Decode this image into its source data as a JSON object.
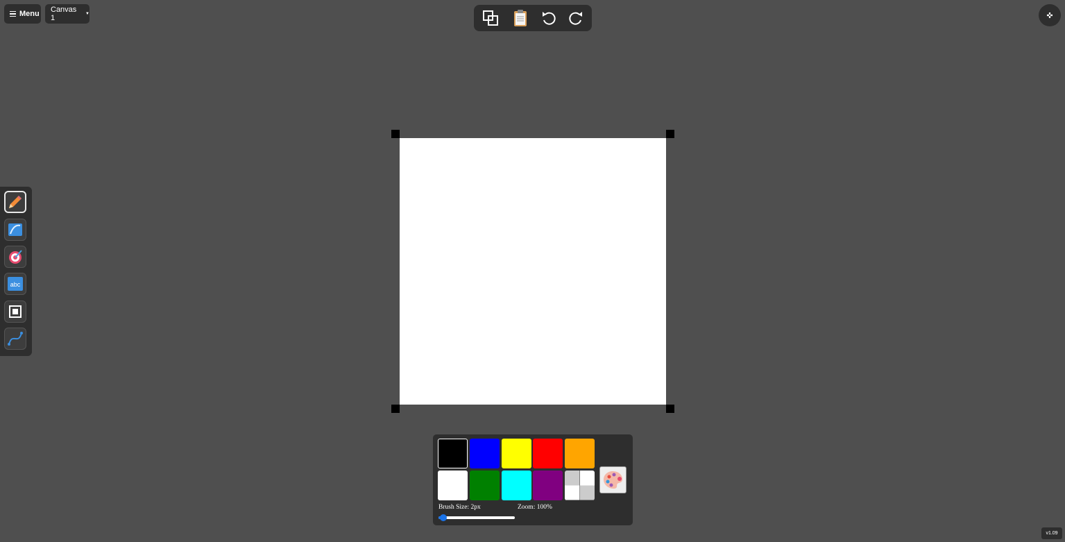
{
  "header": {
    "menu_label": "Menu",
    "canvas_select": {
      "value": "Canvas 1"
    }
  },
  "top_toolbar": {
    "icons": [
      "copy-icon",
      "clipboard-icon",
      "undo-icon",
      "redo-icon"
    ]
  },
  "fullscreen_icon": "fullscreen-icon",
  "tools": [
    {
      "icon": "pencil-icon",
      "active": true
    },
    {
      "icon": "brush-stroke-icon",
      "active": false
    },
    {
      "icon": "target-icon",
      "active": false
    },
    {
      "icon": "text-abc-icon",
      "active": false
    },
    {
      "icon": "frame-icon",
      "active": false
    },
    {
      "icon": "curve-icon",
      "active": false
    }
  ],
  "palette": {
    "colors": [
      {
        "name": "black",
        "hex": "#000000",
        "selected": true
      },
      {
        "name": "blue",
        "hex": "#0000ff",
        "selected": false
      },
      {
        "name": "yellow",
        "hex": "#ffff00",
        "selected": false
      },
      {
        "name": "red",
        "hex": "#ff0000",
        "selected": false
      },
      {
        "name": "orange",
        "hex": "#ffa500",
        "selected": false
      },
      {
        "name": "white",
        "hex": "#ffffff",
        "selected": false
      },
      {
        "name": "green",
        "hex": "#008000",
        "selected": false
      },
      {
        "name": "cyan",
        "hex": "#00ffff",
        "selected": false
      },
      {
        "name": "purple",
        "hex": "#800080",
        "selected": false
      },
      {
        "name": "transparent",
        "hex": "transparent",
        "selected": false
      }
    ],
    "custom_icon": "palette-icon",
    "brush_size_label": "Brush Size: 2px",
    "zoom_label": "Zoom: 100%",
    "brush_size_fraction": 0.02
  },
  "version": "v1.09"
}
